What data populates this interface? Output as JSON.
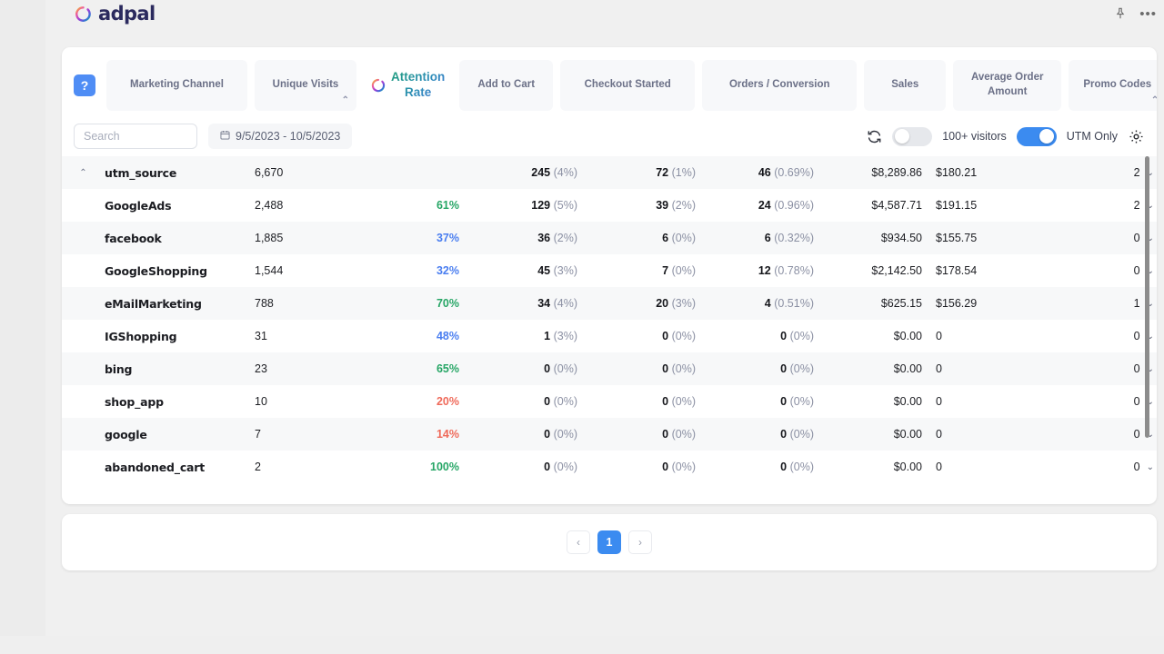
{
  "brand": {
    "name": "adpal"
  },
  "topbar": {
    "pin_icon": "pin-icon",
    "more_icon": "more-options-icon"
  },
  "help_button": {
    "label": "?"
  },
  "columns": [
    {
      "key": "marketing_channel",
      "label": "Marketing Channel",
      "sortable": false,
      "active": false
    },
    {
      "key": "unique_visits",
      "label": "Unique Visits",
      "sortable": true,
      "active": false
    },
    {
      "key": "attention_rate",
      "label": "Attention Rate",
      "sortable": false,
      "active": true
    },
    {
      "key": "add_to_cart",
      "label": "Add to Cart",
      "sortable": false,
      "active": false
    },
    {
      "key": "checkout_started",
      "label": "Checkout Started",
      "sortable": false,
      "active": false
    },
    {
      "key": "orders_conversion",
      "label": "Orders / Conversion",
      "sortable": false,
      "active": false
    },
    {
      "key": "sales",
      "label": "Sales",
      "sortable": false,
      "active": false
    },
    {
      "key": "average_order_amount",
      "label": "Average Order Amount",
      "sortable": false,
      "active": false
    },
    {
      "key": "promo_codes",
      "label": "Promo Codes",
      "sortable": true,
      "active": false
    }
  ],
  "column_labels": {
    "marketing_channel": "Marketing Channel",
    "unique_visits": "Unique Visits",
    "attention_rate_line1": "Attention",
    "attention_rate_line2": "Rate",
    "add_to_cart": "Add to Cart",
    "checkout_started": "Checkout Started",
    "orders_conversion": "Orders / Conversion",
    "sales": "Sales",
    "average_order_amount_line1": "Average Order",
    "average_order_amount_line2": "Amount",
    "promo_codes": "Promo Codes",
    "sort_caret": "⌃"
  },
  "toolbar": {
    "search_placeholder": "Search",
    "search_value": "",
    "date_range": "9/5/2023 - 10/5/2023",
    "refresh_icon": "refresh-icon",
    "visitors_toggle": {
      "label": "100+ visitors",
      "on": false
    },
    "utm_toggle": {
      "label": "UTM Only",
      "on": true
    },
    "settings_icon": "gear-icon"
  },
  "table": {
    "group_row": {
      "expanded": true,
      "expand_caret": "⌃",
      "name": "utm_source",
      "unique_visits": "6,670",
      "attention_rate": "",
      "attention_color": "",
      "add_to_cart": "245",
      "add_to_cart_pct": "(4%)",
      "checkout_started": "72",
      "checkout_started_pct": "(1%)",
      "orders": "46",
      "orders_pct": "(0.69%)",
      "sales": "$8,289.86",
      "aoa": "$180.21",
      "promo_codes": "2"
    },
    "rows": [
      {
        "name": "GoogleAds",
        "unique_visits": "2,488",
        "attention_rate": "61%",
        "attention_color": "g",
        "add_to_cart": "129",
        "add_to_cart_pct": "(5%)",
        "checkout_started": "39",
        "checkout_started_pct": "(2%)",
        "orders": "24",
        "orders_pct": "(0.96%)",
        "sales": "$4,587.71",
        "aoa": "$191.15",
        "promo_codes": "2"
      },
      {
        "name": "facebook",
        "unique_visits": "1,885",
        "attention_rate": "37%",
        "attention_color": "b",
        "add_to_cart": "36",
        "add_to_cart_pct": "(2%)",
        "checkout_started": "6",
        "checkout_started_pct": "(0%)",
        "orders": "6",
        "orders_pct": "(0.32%)",
        "sales": "$934.50",
        "aoa": "$155.75",
        "promo_codes": "0"
      },
      {
        "name": "GoogleShopping",
        "unique_visits": "1,544",
        "attention_rate": "32%",
        "attention_color": "b",
        "add_to_cart": "45",
        "add_to_cart_pct": "(3%)",
        "checkout_started": "7",
        "checkout_started_pct": "(0%)",
        "orders": "12",
        "orders_pct": "(0.78%)",
        "sales": "$2,142.50",
        "aoa": "$178.54",
        "promo_codes": "0"
      },
      {
        "name": "eMailMarketing",
        "unique_visits": "788",
        "attention_rate": "70%",
        "attention_color": "g",
        "add_to_cart": "34",
        "add_to_cart_pct": "(4%)",
        "checkout_started": "20",
        "checkout_started_pct": "(3%)",
        "orders": "4",
        "orders_pct": "(0.51%)",
        "sales": "$625.15",
        "aoa": "$156.29",
        "promo_codes": "1"
      },
      {
        "name": "IGShopping",
        "unique_visits": "31",
        "attention_rate": "48%",
        "attention_color": "b",
        "add_to_cart": "1",
        "add_to_cart_pct": "(3%)",
        "checkout_started": "0",
        "checkout_started_pct": "(0%)",
        "orders": "0",
        "orders_pct": "(0%)",
        "sales": "$0.00",
        "aoa": "0",
        "promo_codes": "0"
      },
      {
        "name": "bing",
        "unique_visits": "23",
        "attention_rate": "65%",
        "attention_color": "g",
        "add_to_cart": "0",
        "add_to_cart_pct": "(0%)",
        "checkout_started": "0",
        "checkout_started_pct": "(0%)",
        "orders": "0",
        "orders_pct": "(0%)",
        "sales": "$0.00",
        "aoa": "0",
        "promo_codes": "0"
      },
      {
        "name": "shop_app",
        "unique_visits": "10",
        "attention_rate": "20%",
        "attention_color": "r",
        "add_to_cart": "0",
        "add_to_cart_pct": "(0%)",
        "checkout_started": "0",
        "checkout_started_pct": "(0%)",
        "orders": "0",
        "orders_pct": "(0%)",
        "sales": "$0.00",
        "aoa": "0",
        "promo_codes": "0"
      },
      {
        "name": "google",
        "unique_visits": "7",
        "attention_rate": "14%",
        "attention_color": "r",
        "add_to_cart": "0",
        "add_to_cart_pct": "(0%)",
        "checkout_started": "0",
        "checkout_started_pct": "(0%)",
        "orders": "0",
        "orders_pct": "(0%)",
        "sales": "$0.00",
        "aoa": "0",
        "promo_codes": "0"
      },
      {
        "name": "abandoned_cart",
        "unique_visits": "2",
        "attention_rate": "100%",
        "attention_color": "g",
        "add_to_cart": "0",
        "add_to_cart_pct": "(0%)",
        "checkout_started": "0",
        "checkout_started_pct": "(0%)",
        "orders": "0",
        "orders_pct": "(0%)",
        "sales": "$0.00",
        "aoa": "0",
        "promo_codes": "0"
      }
    ],
    "row_chevron": "⌄"
  },
  "pagination": {
    "prev": "‹",
    "next": "›",
    "pages": [
      "1"
    ],
    "current": "1"
  },
  "colors": {
    "accent_blue": "#3b8bf0",
    "good_green": "#27a666",
    "mid_blue": "#4a7ef0",
    "low_red": "#ef6a5a",
    "brand_navy": "#2b2a5e",
    "muted_text": "#8b90a3"
  }
}
